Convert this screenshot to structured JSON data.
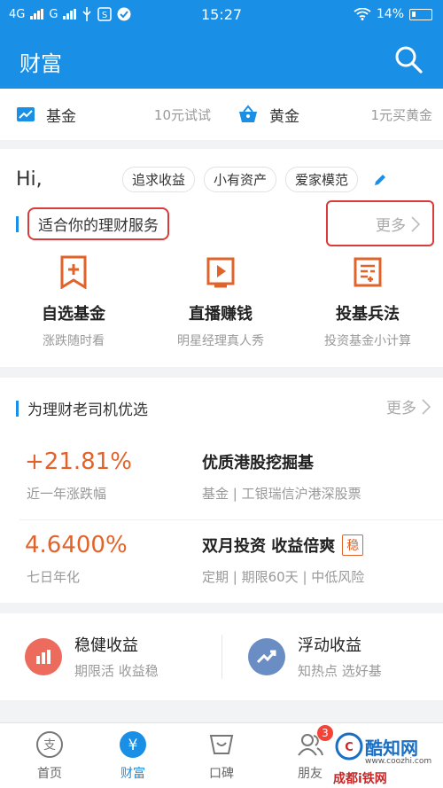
{
  "status_bar": {
    "net1": "4G",
    "net2": "G",
    "time": "15:27",
    "battery": "14%"
  },
  "header": {
    "title": "财富"
  },
  "quick": [
    {
      "name": "基金",
      "sub": "10元试试"
    },
    {
      "name": "黄金",
      "sub": "1元买黄金"
    }
  ],
  "greeting": {
    "hi": "Hi,",
    "tags": [
      "追求收益",
      "小有资产",
      "爱家模范"
    ]
  },
  "services": {
    "title": "适合你的理财服务",
    "more": "更多",
    "items": [
      {
        "name": "自选基金",
        "desc": "涨跌随时看"
      },
      {
        "name": "直播赚钱",
        "desc": "明星经理真人秀"
      },
      {
        "name": "投基兵法",
        "desc": "投资基金小计算"
      }
    ]
  },
  "picks": {
    "title": "为理财老司机优选",
    "more": "更多",
    "items": [
      {
        "value": "+21.81%",
        "label": "近一年涨跌幅",
        "title": "优质港股挖掘基",
        "meta": "基金 | 工银瑞信沪港深股票",
        "badge": ""
      },
      {
        "value": "4.6400%",
        "label": "七日年化",
        "title": "双月投资 收益倍爽",
        "meta": "定期 | 期限60天 | 中低风险",
        "badge": "稳"
      }
    ]
  },
  "pair": [
    {
      "t1": "稳健收益",
      "t2": "期限活  收益稳",
      "color": "#ec6b5c"
    },
    {
      "t1": "浮动收益",
      "t2": "知热点  选好基",
      "color": "#6a8dc4"
    }
  ],
  "tabbar": {
    "tabs": [
      {
        "label": "首页",
        "icon": "alipay-icon"
      },
      {
        "label": "财富",
        "icon": "yen-icon"
      },
      {
        "label": "口碑",
        "icon": "koubei-icon"
      },
      {
        "label": "朋友",
        "icon": "friends-icon",
        "badge": "3"
      }
    ]
  },
  "watermark": {
    "w1": "酷知网",
    "w2": "www.coozhi.com",
    "w3": "成都i铁网"
  },
  "colors": {
    "primary": "#1a8fe6",
    "accent": "#e2632a",
    "highlight": "#d93a3a"
  }
}
